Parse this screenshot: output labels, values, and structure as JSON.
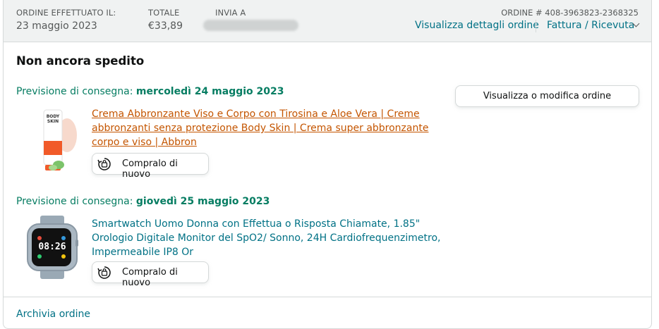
{
  "order_header": {
    "placed_label": "ORDINE EFFETTUATO IL:",
    "placed_date": "23 maggio 2023",
    "total_label": "TOTALE",
    "total_value": "€33,89",
    "ship_to_label": "INVIA A",
    "order_number": "ORDINE # 408-3963823-2368325",
    "details_link": "Visualizza dettagli ordine",
    "invoice_link": "Fattura / Ricevuta"
  },
  "status_title": "Non ancora spedito",
  "modify_button": "Visualizza o modifica ordine",
  "items": [
    {
      "delivery_prefix": "Previsione di consegna: ",
      "delivery_date": "mercoledì 24 maggio 2023",
      "title": "Crema Abbronzante Viso e Corpo con Tirosina e Aloe Vera | Creme abbronzanti senza protezione Body Skin | Crema super abbronzante corpo e viso | Abbron",
      "brand_on_image": "BODY SKIN",
      "buy_again": "Compralo di nuovo"
    },
    {
      "delivery_prefix": "Previsione di consegna: ",
      "delivery_date": "giovedì 25 maggio 2023",
      "title": "Smartwatch Uomo Donna con Effettua o Risposta Chiamate, 1.85\" Orologio Digitale Monitor del SpO2/ Sonno, 24H Cardiofrequenzimetro, Impermeabile IP8 Or",
      "watch_time": "08:26",
      "buy_again": "Compralo di nuovo"
    }
  ],
  "archive_link": "Archivia ordine",
  "colors": {
    "header_bg": "#f0f2f2",
    "link": "#007185",
    "visited_link": "#c45500",
    "delivery_green": "#067d62",
    "border": "#d5d9d9"
  },
  "icons": [
    "chevron-down-icon",
    "buy-again-icon"
  ]
}
